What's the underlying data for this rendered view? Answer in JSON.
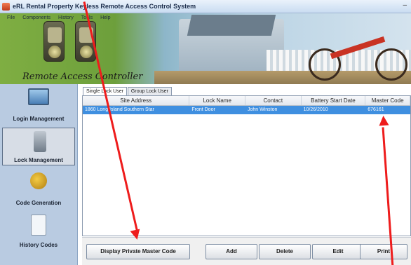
{
  "window": {
    "title": "eRL Rental Property Keyless Remote Access Control System",
    "minimize": "–"
  },
  "menu": [
    "File",
    "Components",
    "History",
    "Tools",
    "Help"
  ],
  "brand": "Remote Access Controller",
  "sidebar": {
    "items": [
      {
        "label": "Login Management",
        "icon": "monitor-icon",
        "active": false
      },
      {
        "label": "Lock Management",
        "icon": "lock-icon",
        "active": true
      },
      {
        "label": "Code Generation",
        "icon": "key-icon",
        "active": false
      },
      {
        "label": "History Codes",
        "icon": "document-icon",
        "active": false
      }
    ]
  },
  "tabs": [
    {
      "label": "Single Lock User",
      "active": true
    },
    {
      "label": "Group Lock User",
      "active": false
    }
  ],
  "table": {
    "columns": [
      "Site Address",
      "Lock Name",
      "Contact",
      "Battery Start Date",
      "Master Code"
    ],
    "rows": [
      [
        "1860 Long Island Southern Star",
        "Front Door",
        "John Winston",
        "10/26/2010",
        "676161"
      ]
    ]
  },
  "buttons": {
    "display_master": "Display Private Master Code",
    "add": "Add",
    "delete": "Delete",
    "edit": "Edit",
    "print": "Print"
  },
  "colors": {
    "annotation_arrow": "#ee1c1c",
    "selected_row": "#3f8fe0"
  }
}
